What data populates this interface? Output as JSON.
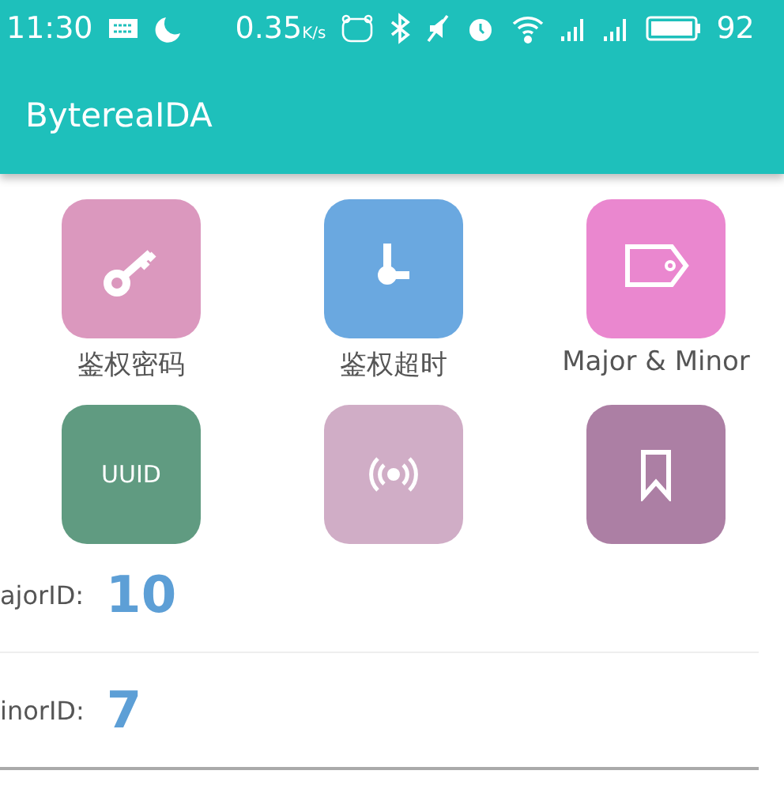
{
  "status_bar": {
    "time": "11:30",
    "speed": "0.35",
    "speed_unit": "K/s",
    "battery_text": "92"
  },
  "app_bar": {
    "title": "BytereaIDA"
  },
  "tiles": [
    {
      "kind": "key",
      "label": "鉴权密码",
      "color": "#db98be"
    },
    {
      "kind": "clock",
      "label": "鉴权超时",
      "color": "#6aa8e0"
    },
    {
      "kind": "tag",
      "label": "Major & Minor",
      "color": "#ea87cf"
    },
    {
      "kind": "text",
      "text": "UUID",
      "color": "#609b81"
    },
    {
      "kind": "signal",
      "color": "#d0adc6"
    },
    {
      "kind": "bookmark",
      "color": "#ac7fa4"
    }
  ],
  "fields": [
    {
      "label": "ajorID:",
      "value": "10"
    },
    {
      "label": "inorID:",
      "value": "7"
    }
  ]
}
